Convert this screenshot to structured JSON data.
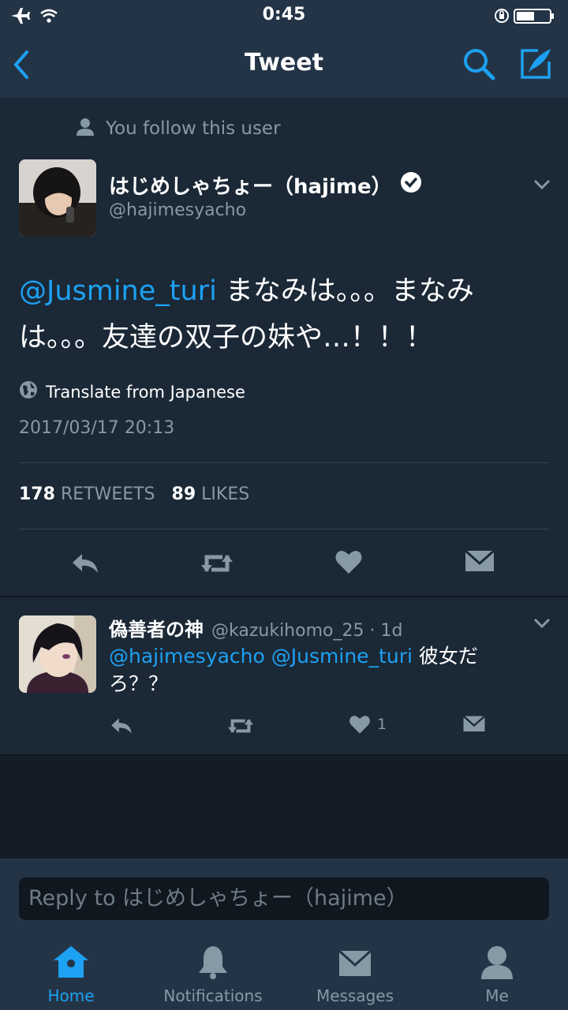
{
  "status": {
    "time": "0:45"
  },
  "nav": {
    "title": "Tweet"
  },
  "tweet": {
    "follow_note": "You follow this user",
    "author_name": "はじめしゃちょー（hajime）",
    "author_handle": "@hajimesyacho",
    "mention": "@Jusmine_turi",
    "text": " まなみは。。。まなみは。。。友達の双子の妹や…！！！",
    "translate_label": "Translate from Japanese",
    "date": "2017/03/17 20:13",
    "retweets_count": "178",
    "retweets_label": "RETWEETS",
    "likes_count": "89",
    "likes_label": "LIKES"
  },
  "reply_tweet": {
    "author_name": "偽善者の神",
    "meta": "@kazukihomo_25 · 1d",
    "mention1": "@hajimesyacho",
    "mention2": "@Jusmine_turi",
    "text": " 彼女だろ？？",
    "like_count": "1"
  },
  "composer": {
    "placeholder": "Reply to はじめしゃちょー（hajime）"
  },
  "tabs": [
    {
      "label": "Home",
      "icon": "home-icon"
    },
    {
      "label": "Notifications",
      "icon": "bell-icon"
    },
    {
      "label": "Messages",
      "icon": "envelope-icon"
    },
    {
      "label": "Me",
      "icon": "person-icon"
    }
  ],
  "colors": {
    "accent": "#1da1f2",
    "bg": "#1b2836",
    "bar": "#243447",
    "muted": "#8899a6"
  }
}
